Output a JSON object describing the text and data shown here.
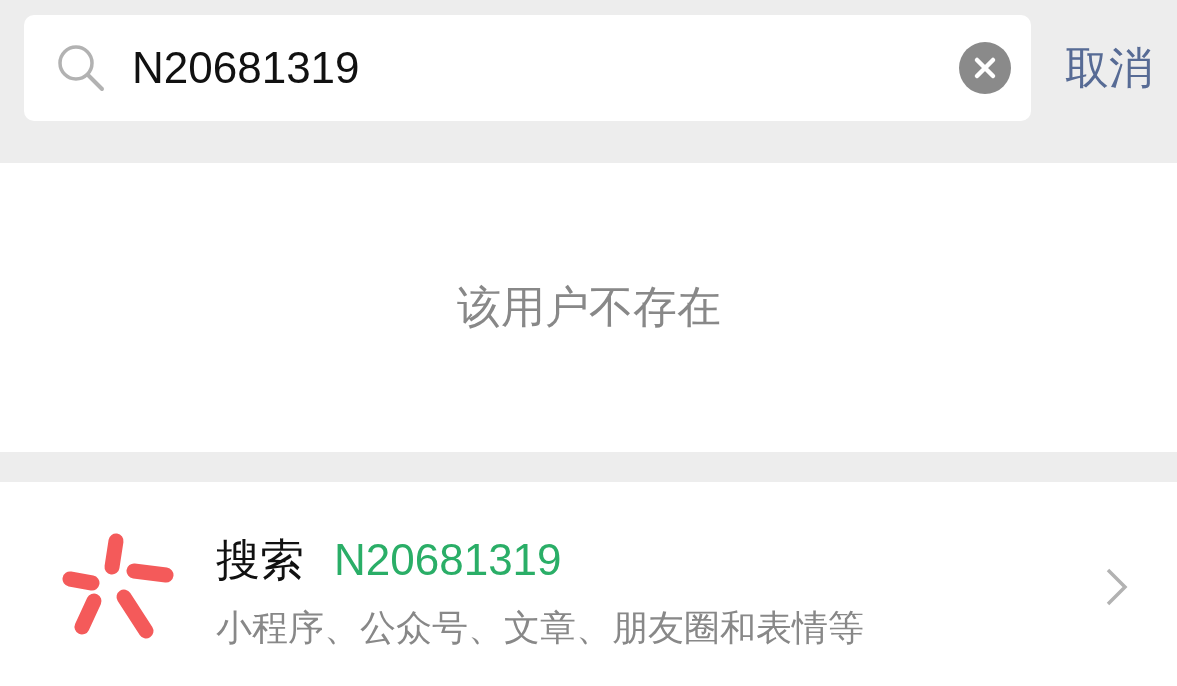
{
  "search": {
    "value": "N20681319",
    "cancel": "取消"
  },
  "message": "该用户不存在",
  "suggestion": {
    "action": "搜索",
    "query": "N20681319",
    "description": "小程序、公众号、文章、朋友圈和表情等"
  }
}
